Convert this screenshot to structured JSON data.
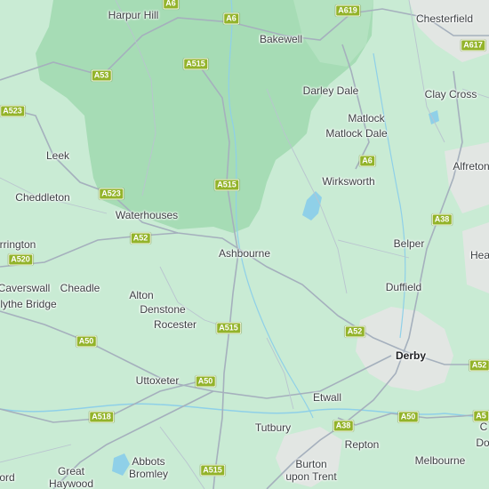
{
  "map": {
    "colors": {
      "land": "#c9ebd4",
      "national_park": "#a6dcb5",
      "water": "#8fd0e8",
      "road": "#a5b0bd",
      "urban": "#e2e6e3",
      "shield": "#93b32a"
    },
    "places": [
      {
        "id": "harpur-hill",
        "label": "Harpur Hill"
      },
      {
        "id": "bakewell",
        "label": "Bakewell"
      },
      {
        "id": "chesterfield",
        "label": "Chesterfield"
      },
      {
        "id": "darley-dale",
        "label": "Darley Dale"
      },
      {
        "id": "clay-cross",
        "label": "Clay Cross"
      },
      {
        "id": "matlock",
        "label": "Matlock"
      },
      {
        "id": "matlock-dale",
        "label": "Matlock Dale"
      },
      {
        "id": "leek",
        "label": "Leek"
      },
      {
        "id": "alfreton",
        "label": "Alfreton"
      },
      {
        "id": "cheddleton",
        "label": "Cheddleton"
      },
      {
        "id": "wirksworth",
        "label": "Wirksworth"
      },
      {
        "id": "waterhouses",
        "label": "Waterhouses"
      },
      {
        "id": "belper",
        "label": "Belper"
      },
      {
        "id": "arrington",
        "label": "rrington"
      },
      {
        "id": "ashbourne",
        "label": "Ashbourne"
      },
      {
        "id": "heanor",
        "label": "Hea"
      },
      {
        "id": "caverswall",
        "label": "Caverswall"
      },
      {
        "id": "cheadle",
        "label": "Cheadle"
      },
      {
        "id": "duffield",
        "label": "Duffield"
      },
      {
        "id": "alton",
        "label": "Alton"
      },
      {
        "id": "blythe-bridge",
        "label": "lythe Bridge"
      },
      {
        "id": "denstone",
        "label": "Denstone"
      },
      {
        "id": "rocester",
        "label": "Rocester"
      },
      {
        "id": "derby",
        "label": "Derby"
      },
      {
        "id": "uttoxeter",
        "label": "Uttoxeter"
      },
      {
        "id": "etwall",
        "label": "Etwall"
      },
      {
        "id": "chaddesden",
        "label": "C"
      },
      {
        "id": "do",
        "label": "Do"
      },
      {
        "id": "tutbury",
        "label": "Tutbury"
      },
      {
        "id": "repton",
        "label": "Repton"
      },
      {
        "id": "abbots-bromley",
        "label": "Abbots\nBromley"
      },
      {
        "id": "melbourne",
        "label": "Melbourne"
      },
      {
        "id": "burton",
        "label": "Burton\nupon Trent"
      },
      {
        "id": "great-haywood",
        "label": "Great\nHaywood"
      },
      {
        "id": "stafford",
        "label": "ord"
      }
    ],
    "roads": [
      {
        "id": "a6-top",
        "label": "A6"
      },
      {
        "id": "a6-top2",
        "label": "A6"
      },
      {
        "id": "a619",
        "label": "A619"
      },
      {
        "id": "a617",
        "label": "A617"
      },
      {
        "id": "a53",
        "label": "A53"
      },
      {
        "id": "a515-n",
        "label": "A515"
      },
      {
        "id": "a523-nw",
        "label": "A523"
      },
      {
        "id": "a6-mid",
        "label": "A6"
      },
      {
        "id": "a515-mid",
        "label": "A515"
      },
      {
        "id": "a523",
        "label": "A523"
      },
      {
        "id": "a38-n",
        "label": "A38"
      },
      {
        "id": "a52-w",
        "label": "A52"
      },
      {
        "id": "a520",
        "label": "A520"
      },
      {
        "id": "a515-s",
        "label": "A515"
      },
      {
        "id": "a52-e",
        "label": "A52"
      },
      {
        "id": "a50-w",
        "label": "A50"
      },
      {
        "id": "a52-se",
        "label": "A52"
      },
      {
        "id": "a50-mid",
        "label": "A50"
      },
      {
        "id": "a518",
        "label": "A518"
      },
      {
        "id": "a38-s",
        "label": "A38"
      },
      {
        "id": "a50-e",
        "label": "A50"
      },
      {
        "id": "a5-se",
        "label": "A5"
      },
      {
        "id": "a515-bottom",
        "label": "A515"
      }
    ]
  }
}
